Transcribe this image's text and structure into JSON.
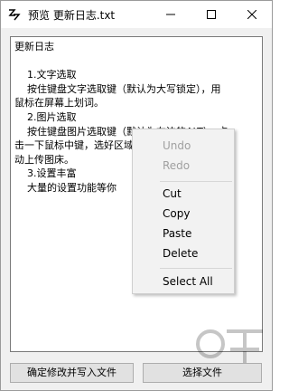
{
  "window": {
    "title": "预览 更新日志.txt",
    "controls": {
      "minimize": "minimize",
      "maximize": "maximize",
      "close": "close"
    }
  },
  "editor": {
    "content": "更新日志\n\n    1.文字选取\n    按住键盘文字选取键（默认为大写锁定），用\n鼠标在屏幕上划词。\n    2.图片选取\n    按住键盘图片选取键（默认为左边的ALT），点\n击一下鼠标中键，选好区域后松开左键可自\n动上传图床。\n    3.设置丰富\n    大量的设置功能等你"
  },
  "context_menu": {
    "undo": "Undo",
    "redo": "Redo",
    "cut": "Cut",
    "copy": "Copy",
    "paste": "Paste",
    "delete": "Delete",
    "select_all": "Select All"
  },
  "buttons": {
    "confirm": "确定修改并写入文件",
    "choose_file": "选择文件"
  },
  "colors": {
    "window_bg": "#f0f0f0",
    "disabled_text": "#a0a0a0",
    "button_bg": "#e1e1e1"
  }
}
